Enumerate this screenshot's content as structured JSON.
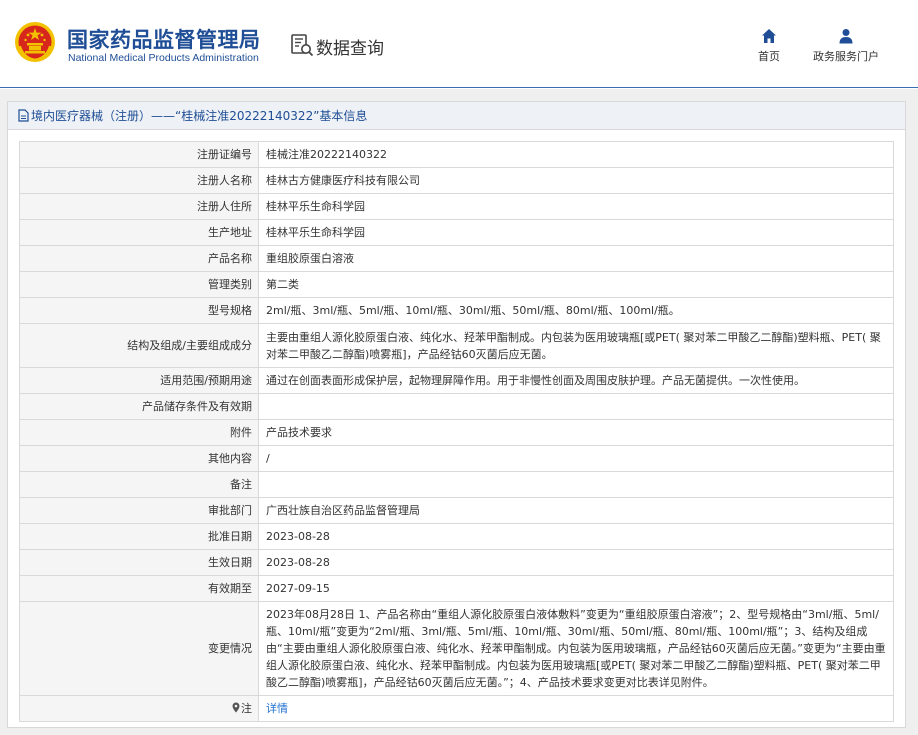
{
  "header": {
    "org_name_cn": "国家药品监督管理局",
    "org_name_en": "National Medical Products Administration",
    "section_title": "数据查询",
    "nav": [
      {
        "label": "首页",
        "icon": "home-icon"
      },
      {
        "label": "政务服务门户",
        "icon": "user-icon"
      }
    ]
  },
  "colors": {
    "brand_blue": "#1f4e96",
    "emblem_red": "#d7261c",
    "emblem_gold": "#f2c200",
    "link_blue": "#1f6fd1"
  },
  "panel": {
    "title": "境内医疗器械（注册）——“桂械注准20222140322”基本信息"
  },
  "rows": [
    {
      "label": "注册证编号",
      "value": "桂械注准20222140322"
    },
    {
      "label": "注册人名称",
      "value": "桂林古方健康医疗科技有限公司"
    },
    {
      "label": "注册人住所",
      "value": "桂林平乐生命科学园"
    },
    {
      "label": "生产地址",
      "value": "桂林平乐生命科学园"
    },
    {
      "label": "产品名称",
      "value": "重组胶原蛋白溶液"
    },
    {
      "label": "管理类别",
      "value": "第二类"
    },
    {
      "label": "型号规格",
      "value": "2ml/瓶、3ml/瓶、5ml/瓶、10ml/瓶、30ml/瓶、50ml/瓶、80ml/瓶、100ml/瓶。"
    },
    {
      "label": "结构及组成/主要组成成分",
      "value": "主要由重组人源化胶原蛋白液、纯化水、羟苯甲酯制成。内包装为医用玻璃瓶[或PET( 聚对苯二甲酸乙二醇酯)塑料瓶、PET( 聚对苯二甲酸乙二醇酯)喷雾瓶]，产品经钴60灭菌后应无菌。"
    },
    {
      "label": "适用范围/预期用途",
      "value": "通过在创面表面形成保护层，起物理屏障作用。用于非慢性创面及周围皮肤护理。产品无菌提供。一次性使用。"
    },
    {
      "label": "产品储存条件及有效期",
      "value": ""
    },
    {
      "label": "附件",
      "value": "产品技术要求"
    },
    {
      "label": "其他内容",
      "value": "/"
    },
    {
      "label": "备注",
      "value": ""
    },
    {
      "label": "审批部门",
      "value": "广西壮族自治区药品监督管理局"
    },
    {
      "label": "批准日期",
      "value": "2023-08-28"
    },
    {
      "label": "生效日期",
      "value": "2023-08-28"
    },
    {
      "label": "有效期至",
      "value": "2027-09-15"
    },
    {
      "label": "变更情况",
      "value": "2023年08月28日 1、产品名称由“重组人源化胶原蛋白液体敷料”变更为“重组胶原蛋白溶液”；2、型号规格由“3ml/瓶、5ml/瓶、10ml/瓶”变更为“2ml/瓶、3ml/瓶、5ml/瓶、10ml/瓶、30ml/瓶、50ml/瓶、80ml/瓶、100ml/瓶”；3、结构及组成由“主要由重组人源化胶原蛋白液、纯化水、羟苯甲酯制成。内包装为医用玻璃瓶，产品经钴60灭菌后应无菌。”变更为“主要由重组人源化胶原蛋白液、纯化水、羟苯甲酯制成。内包装为医用玻璃瓶[或PET( 聚对苯二甲酸乙二醇酯)塑料瓶、PET( 聚对苯二甲酸乙二醇酯)喷雾瓶]，产品经钴60灭菌后应无菌。”；4、产品技术要求变更对比表详见附件。"
    }
  ],
  "note_row": {
    "label": "注",
    "link_text": "详情",
    "icon": "pin-icon"
  }
}
